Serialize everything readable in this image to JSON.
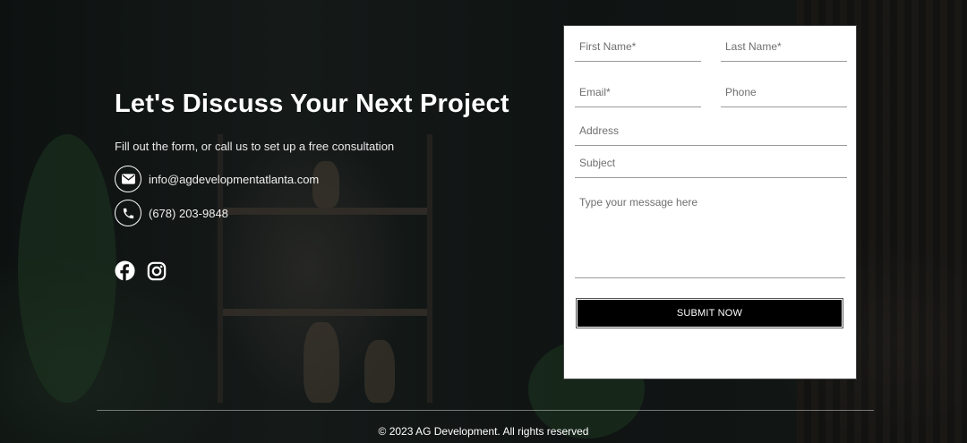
{
  "hero": {
    "title": "Let's Discuss Your Next Project",
    "subtitle": "Fill out the form, or call us to set up a free consultation",
    "email": "info@agdevelopmentatlanta.com",
    "phone": "(678) 203-9848"
  },
  "socials": [
    {
      "icon": "facebook-icon"
    },
    {
      "icon": "instagram-icon"
    }
  ],
  "form": {
    "first_name": {
      "placeholder": "First Name*",
      "value": ""
    },
    "last_name": {
      "placeholder": "Last Name*",
      "value": ""
    },
    "email": {
      "placeholder": "Email*",
      "value": ""
    },
    "phone": {
      "placeholder": "Phone",
      "value": ""
    },
    "address": {
      "placeholder": "Address",
      "value": ""
    },
    "subject": {
      "placeholder": "Subject",
      "value": ""
    },
    "message": {
      "placeholder": "Type your message here",
      "value": ""
    },
    "submit_label": "SUBMIT NOW"
  },
  "footer": {
    "copyright": "© 2023 AG Development. All rights reserved"
  }
}
